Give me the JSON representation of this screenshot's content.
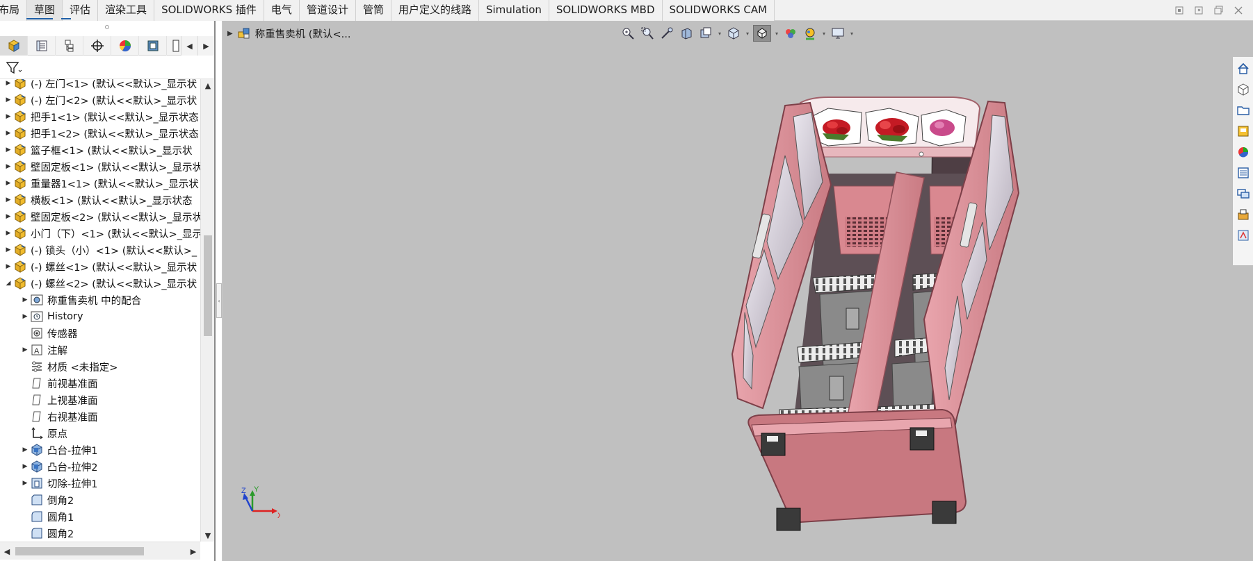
{
  "tabs": [
    {
      "label": "布局"
    },
    {
      "label": "草图",
      "active": true
    },
    {
      "label": "评估"
    },
    {
      "label": "渲染工具"
    },
    {
      "label": "SOLIDWORKS 插件"
    },
    {
      "label": "电气"
    },
    {
      "label": "管道设计"
    },
    {
      "label": "管筒"
    },
    {
      "label": "用户定义的线路"
    },
    {
      "label": "Simulation"
    },
    {
      "label": "SOLIDWORKS MBD"
    },
    {
      "label": "SOLIDWORKS CAM"
    }
  ],
  "window_controls": [
    "restore-icon",
    "maximize-icon",
    "minimize-icon",
    "close-icon"
  ],
  "manager_tabs": [
    "featuremanager-icon",
    "propertymanager-icon",
    "configurationmanager-icon",
    "dimxpert-icon",
    "displaymanager-icon",
    "cam-feature-icon",
    "cam-operation-icon"
  ],
  "tree": {
    "items": [
      {
        "label": "(-) 左门<1> (默认<<默认>_显示状",
        "icon": "part",
        "caret": "right"
      },
      {
        "label": "(-) 左门<2> (默认<<默认>_显示状",
        "icon": "part",
        "caret": "right"
      },
      {
        "label": "把手1<1> (默认<<默认>_显示状态",
        "icon": "part",
        "caret": "right"
      },
      {
        "label": "把手1<2> (默认<<默认>_显示状态",
        "icon": "part",
        "caret": "right"
      },
      {
        "label": "篮子框<1> (默认<<默认>_显示状",
        "icon": "part",
        "caret": "right"
      },
      {
        "label": "壁固定板<1> (默认<<默认>_显示状",
        "icon": "part",
        "caret": "right"
      },
      {
        "label": "重量器1<1> (默认<<默认>_显示状",
        "icon": "part",
        "caret": "right"
      },
      {
        "label": "横板<1> (默认<<默认>_显示状态",
        "icon": "part",
        "caret": "right"
      },
      {
        "label": "壁固定板<2> (默认<<默认>_显示状",
        "icon": "part",
        "caret": "right"
      },
      {
        "label": "小门（下）<1> (默认<<默认>_显示",
        "icon": "part",
        "caret": "right"
      },
      {
        "label": "(-) 锁头（小）<1> (默认<<默认>_",
        "icon": "part",
        "caret": "right"
      },
      {
        "label": "(-) 螺丝<1> (默认<<默认>_显示状",
        "icon": "part",
        "caret": "right"
      },
      {
        "label": "(-) 螺丝<2> (默认<<默认>_显示状",
        "icon": "part",
        "caret": "down"
      },
      {
        "label": "称重售卖机 中的配合",
        "icon": "mates",
        "caret": "right",
        "indent": 1
      },
      {
        "label": "History",
        "icon": "history",
        "caret": "right",
        "indent": 1
      },
      {
        "label": "传感器",
        "icon": "sensor",
        "caret": "",
        "indent": 1
      },
      {
        "label": "注解",
        "icon": "annotation",
        "caret": "right",
        "indent": 1
      },
      {
        "label": "材质 <未指定>",
        "icon": "material",
        "caret": "",
        "indent": 1
      },
      {
        "label": "前视基准面",
        "icon": "plane",
        "caret": "",
        "indent": 1
      },
      {
        "label": "上视基准面",
        "icon": "plane",
        "caret": "",
        "indent": 1
      },
      {
        "label": "右视基准面",
        "icon": "plane",
        "caret": "",
        "indent": 1
      },
      {
        "label": "原点",
        "icon": "origin",
        "caret": "",
        "indent": 1
      },
      {
        "label": "凸台-拉伸1",
        "icon": "extrude",
        "caret": "right",
        "indent": 1
      },
      {
        "label": "凸台-拉伸2",
        "icon": "extrude",
        "caret": "right",
        "indent": 1
      },
      {
        "label": "切除-拉伸1",
        "icon": "cut",
        "caret": "right",
        "indent": 1
      },
      {
        "label": "倒角2",
        "icon": "chamfer",
        "caret": "",
        "indent": 1
      },
      {
        "label": "圆角1",
        "icon": "fillet",
        "caret": "",
        "indent": 1
      },
      {
        "label": "圆角2",
        "icon": "fillet",
        "caret": "",
        "indent": 1
      }
    ]
  },
  "breadcrumb": {
    "text": "称重售卖机  (默认<..."
  },
  "heads_up_icons": [
    "zoom-to-fit-icon",
    "zoom-to-area-icon",
    "previous-view-icon",
    "section-view-icon",
    "dynamic-annotation-icon",
    "view-orientation-icon",
    "display-style-icon",
    "hide-show-items-icon",
    "edit-appearance-icon",
    "apply-scene-icon",
    "view-settings-icon"
  ],
  "task_pane_icons": [
    "home-icon",
    "3d-components-icon",
    "design-library-icon",
    "file-explorer-icon",
    "appearances-icon",
    "custom-properties-icon",
    "forum-icon",
    "cam-icon",
    "tolerance-icon"
  ],
  "triad": {
    "x_label": "X",
    "y_label": "Y",
    "z_label": "Z"
  },
  "colors": {
    "body_pink": "#d98b93",
    "dark_side": "#4e3e44",
    "tab_accent": "#1f5fa8",
    "viewport_bg": "#c0c0c0"
  }
}
